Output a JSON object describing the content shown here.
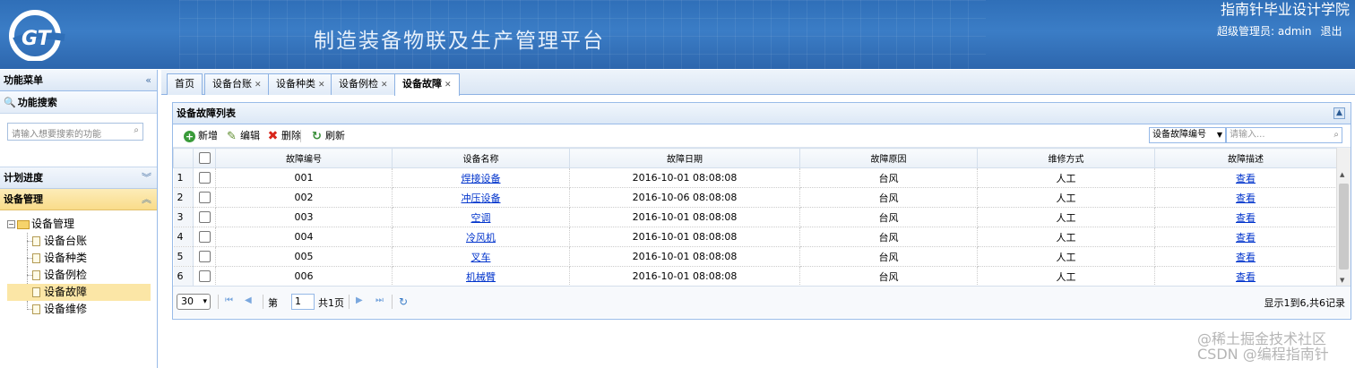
{
  "header": {
    "app_title": "制造装备物联及生产管理平台",
    "org_name": "指南针毕业设计学院",
    "user_label": "超级管理员: admin",
    "logout_label": "退出"
  },
  "sidebar": {
    "title": "功能菜单",
    "search_title": "功能搜索",
    "search_placeholder": "请输入想要搜索的功能",
    "groups": [
      "计划进度",
      "设备管理"
    ],
    "tree": {
      "root": "设备管理",
      "items": [
        "设备台账",
        "设备种类",
        "设备例检",
        "设备故障",
        "设备维修"
      ],
      "selected": "设备故障"
    }
  },
  "tabs": [
    {
      "label": "首页",
      "closable": false
    },
    {
      "label": "设备台账",
      "closable": true
    },
    {
      "label": "设备种类",
      "closable": true
    },
    {
      "label": "设备例检",
      "closable": true
    },
    {
      "label": "设备故障",
      "closable": true,
      "active": true
    }
  ],
  "panel": {
    "title": "设备故障列表",
    "toolbar": {
      "add": "新增",
      "edit": "编辑",
      "delete": "删除",
      "refresh": "刷新"
    },
    "search_field": "设备故障编号",
    "search_placeholder": "请输入..."
  },
  "table": {
    "columns": [
      "故障编号",
      "设备名称",
      "故障日期",
      "故障原因",
      "维修方式",
      "故障描述"
    ],
    "rows": [
      {
        "n": "1",
        "code": "001",
        "name": "焊接设备",
        "date": "2016-10-01 08:08:08",
        "reason": "台风",
        "method": "人工",
        "desc": "查看"
      },
      {
        "n": "2",
        "code": "002",
        "name": "冲压设备",
        "date": "2016-10-06 08:08:08",
        "reason": "台风",
        "method": "人工",
        "desc": "查看"
      },
      {
        "n": "3",
        "code": "003",
        "name": "空调",
        "date": "2016-10-01 08:08:08",
        "reason": "台风",
        "method": "人工",
        "desc": "查看"
      },
      {
        "n": "4",
        "code": "004",
        "name": "冷风机",
        "date": "2016-10-01 08:08:08",
        "reason": "台风",
        "method": "人工",
        "desc": "查看"
      },
      {
        "n": "5",
        "code": "005",
        "name": "叉车",
        "date": "2016-10-01 08:08:08",
        "reason": "台风",
        "method": "人工",
        "desc": "查看"
      },
      {
        "n": "6",
        "code": "006",
        "name": "机械臂",
        "date": "2016-10-01 08:08:08",
        "reason": "台风",
        "method": "人工",
        "desc": "查看"
      }
    ]
  },
  "pager": {
    "page_size": "30",
    "page_prefix": "第",
    "page_value": "1",
    "page_suffix": "共1页",
    "info": "显示1到6,共6记录"
  },
  "watermark": {
    "line1": "@稀土掘金技术社区",
    "line2": "CSDN @编程指南针"
  },
  "colors": {
    "header_blue": "#2f6fb8",
    "selected_yellow": "#fbe6a6",
    "link_blue": "#0033cc"
  }
}
